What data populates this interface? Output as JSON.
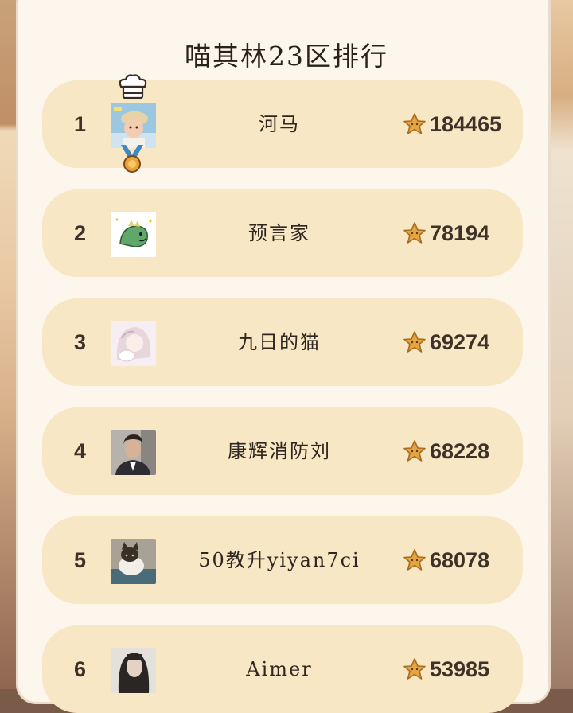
{
  "header": {
    "title": "喵其林23区排行"
  },
  "leaderboard": [
    {
      "rank": "1",
      "name": "河马",
      "score": "184465",
      "avatar": "baby-with-hat-avatar"
    },
    {
      "rank": "2",
      "name": "预言家",
      "score": "78194",
      "avatar": "green-dinosaur-avatar"
    },
    {
      "rank": "3",
      "name": "九日的猫",
      "score": "69274",
      "avatar": "anime-girl-with-cat-avatar"
    },
    {
      "rank": "4",
      "name": "康辉消防刘",
      "score": "68228",
      "avatar": "man-in-suit-avatar"
    },
    {
      "rank": "5",
      "name": "50教升yiyan7ci",
      "score": "68078",
      "avatar": "cat-photo-avatar"
    },
    {
      "rank": "6",
      "name": "Aimer",
      "score": "53985",
      "avatar": "dark-hair-girl-avatar"
    }
  ],
  "icons": {
    "score": "star-icon",
    "first_place": "crown-icon",
    "first_place_badge": "medal-icon"
  },
  "colors": {
    "panel": "#fcf6ec",
    "row": "#f8e7c4",
    "star": "#e6a63f",
    "text": "#3d3128"
  }
}
